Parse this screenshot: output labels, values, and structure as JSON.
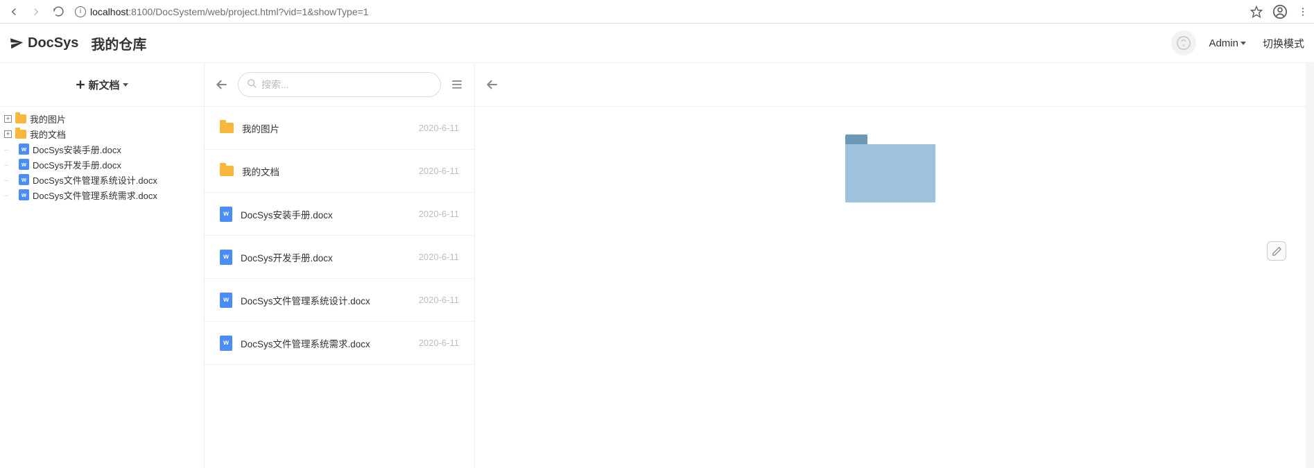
{
  "browser": {
    "url_host": "localhost",
    "url_path": ":8100/DocSystem/web/project.html?vid=1&showType=1"
  },
  "brand": {
    "name": "DocSys"
  },
  "header": {
    "repo_title": "我的仓库",
    "admin_label": "Admin",
    "switch_mode_label": "切换模式"
  },
  "tree_toolbar": {
    "new_doc_label": "新文档"
  },
  "tree": {
    "nodes": [
      {
        "type": "folder",
        "label": "我的图片",
        "expandable": true
      },
      {
        "type": "folder",
        "label": "我的文档",
        "expandable": true
      },
      {
        "type": "file",
        "label": "DocSys安装手册.docx"
      },
      {
        "type": "file",
        "label": "DocSys开发手册.docx"
      },
      {
        "type": "file",
        "label": "DocSys文件管理系统设计.docx"
      },
      {
        "type": "file",
        "label": "DocSys文件管理系统需求.docx"
      }
    ]
  },
  "search": {
    "placeholder": "搜索..."
  },
  "list": {
    "items": [
      {
        "type": "folder",
        "name": "我的图片",
        "date": "2020-6-11"
      },
      {
        "type": "folder",
        "name": "我的文档",
        "date": "2020-6-11"
      },
      {
        "type": "file",
        "name": "DocSys安装手册.docx",
        "date": "2020-6-11"
      },
      {
        "type": "file",
        "name": "DocSys开发手册.docx",
        "date": "2020-6-11"
      },
      {
        "type": "file",
        "name": "DocSys文件管理系统设计.docx",
        "date": "2020-6-11"
      },
      {
        "type": "file",
        "name": "DocSys文件管理系统需求.docx",
        "date": "2020-6-11"
      }
    ]
  }
}
